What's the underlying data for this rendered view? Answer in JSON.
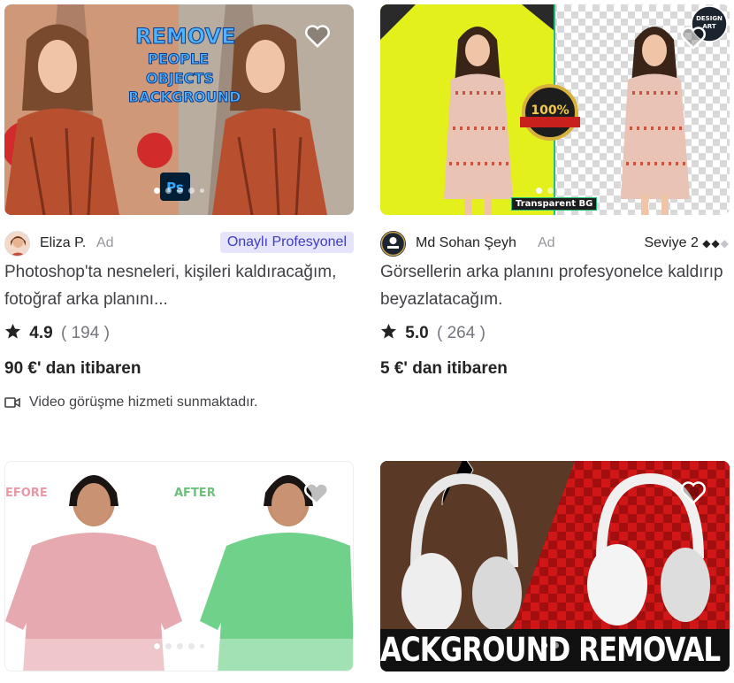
{
  "cards": [
    {
      "seller": "Eliza P.",
      "ad": "Ad",
      "badge": "Onaylı Profesyonel",
      "title": "Photoshop'ta nesneleri, kişileri kaldıracağım, fotoğraf arka planını...",
      "rating": "4.9",
      "reviews": "( 194 )",
      "price": "90 €' dan itibaren",
      "video": "Video görüşme hizmeti sunmaktadır.",
      "image_text": [
        "REMOVE",
        "PEOPLE",
        "OBJECTS",
        "BACKGROUND"
      ],
      "ps_label": "Ps"
    },
    {
      "seller": "Md Sohan Şeyh",
      "ad": "Ad",
      "level": "Seviye 2",
      "level_diamonds": "◆◆◆",
      "title": "Görsellerin arka planını profesyonelce kaldırıp beyazlatacağım.",
      "rating": "5.0",
      "reviews": "( 264 )",
      "price": "5 €' dan itibaren",
      "image_text": [
        "100%",
        "Transparent BG"
      ],
      "logo_text": "DESIGN ART"
    },
    {
      "image_text": [
        "EFORE",
        "AFTER"
      ]
    },
    {
      "image_text": [
        "ACKGROUND REMOVAL PR"
      ]
    }
  ],
  "colors": {
    "accent": "#3f3dbb",
    "badge_bg": "#e5e4fb",
    "muted": "#74767e",
    "text": "#222325"
  },
  "icons": {
    "favorite": "heart-icon",
    "rating": "star-icon",
    "video": "video-camera-icon"
  }
}
